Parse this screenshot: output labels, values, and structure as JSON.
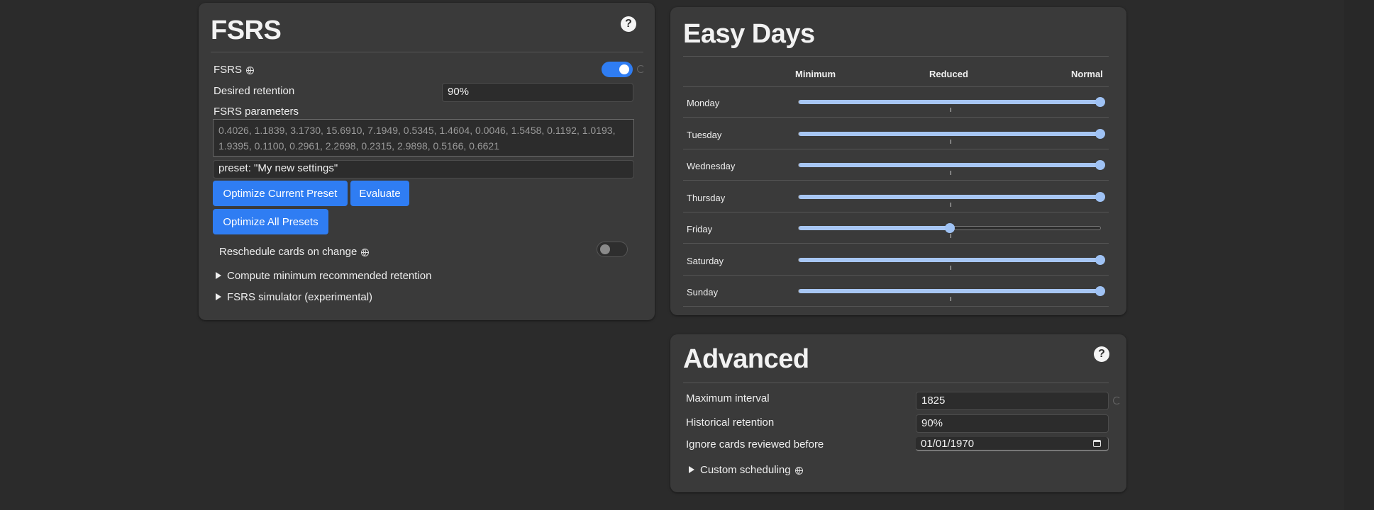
{
  "fsrs": {
    "title": "FSRS",
    "help": "?",
    "toggle_label": "FSRS",
    "toggle_on": true,
    "desired_retention_label": "Desired retention",
    "desired_retention_value": "90%",
    "params_label": "FSRS parameters",
    "params_placeholder": "0.4026, 1.1839, 3.1730, 15.6910, 7.1949, 0.5345, 1.4604, 0.0046, 1.5458, 0.1192, 1.0193, 1.9395, 0.1100, 0.2961, 2.2698, 0.2315, 2.9898, 0.5166, 0.6621",
    "search_value": "preset: \"My new settings\"",
    "optimize_current_label": "Optimize Current Preset",
    "evaluate_label": "Evaluate",
    "optimize_all_label": "Optimize All Presets",
    "reschedule_label": "Reschedule cards on change",
    "reschedule_on": false,
    "compute_min_label": "Compute minimum recommended retention",
    "simulator_label": "FSRS simulator (experimental)"
  },
  "easy_days": {
    "title": "Easy Days",
    "columns": [
      "Minimum",
      "Reduced",
      "Normal"
    ],
    "days": [
      {
        "label": "Monday",
        "level": 1.0
      },
      {
        "label": "Tuesday",
        "level": 1.0
      },
      {
        "label": "Wednesday",
        "level": 1.0
      },
      {
        "label": "Thursday",
        "level": 1.0
      },
      {
        "label": "Friday",
        "level": 0.5
      },
      {
        "label": "Saturday",
        "level": 1.0
      },
      {
        "label": "Sunday",
        "level": 1.0
      }
    ]
  },
  "advanced": {
    "title": "Advanced",
    "help": "?",
    "max_interval_label": "Maximum interval",
    "max_interval_value": "1825",
    "historical_retention_label": "Historical retention",
    "historical_retention_value": "90%",
    "ignore_before_label": "Ignore cards reviewed before",
    "ignore_before_value": "01/01/1970",
    "custom_scheduling_label": "Custom scheduling"
  },
  "colors": {
    "accent": "#2f7df3",
    "slider": "#a7c6f3",
    "card_bg": "#3a3a3a",
    "page_bg": "#2b2b2b"
  }
}
